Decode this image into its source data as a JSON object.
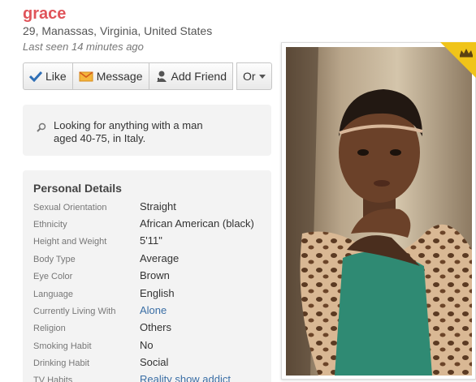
{
  "profile": {
    "name": "grace",
    "location": "29, Manassas, Virginia, United States",
    "last_seen": "Last seen 14 minutes ago"
  },
  "actions": {
    "like": "Like",
    "message": "Message",
    "add_friend": "Add Friend",
    "or": "Or"
  },
  "looking_for": {
    "line1": "Looking for anything with a man",
    "line2": "aged 40-75, in Italy."
  },
  "details": {
    "title": "Personal Details",
    "rows": [
      {
        "key": "Sexual Orientation",
        "value": "Straight"
      },
      {
        "key": "Ethnicity",
        "value": "African American (black)"
      },
      {
        "key": "Height and Weight",
        "value": "5'11\""
      },
      {
        "key": "Body Type",
        "value": "Average"
      },
      {
        "key": "Eye Color",
        "value": "Brown"
      },
      {
        "key": "Language",
        "value": "English"
      },
      {
        "key": "Currently Living With",
        "value": "Alone"
      },
      {
        "key": "Religion",
        "value": "Others"
      },
      {
        "key": "Smoking Habit",
        "value": "No"
      },
      {
        "key": "Drinking Habit",
        "value": "Social"
      },
      {
        "key": "TV Habits",
        "value": "Reality show addict"
      }
    ]
  },
  "colors": {
    "name": "#e0545a",
    "link": "#3a6ea5",
    "crown_badge": "#f0c419"
  },
  "icons": {
    "like": "check-icon",
    "message": "envelope-icon",
    "add_friend": "person-add-icon",
    "or": "caret-down-icon",
    "search": "magnifier-icon",
    "premium": "crown-icon"
  }
}
